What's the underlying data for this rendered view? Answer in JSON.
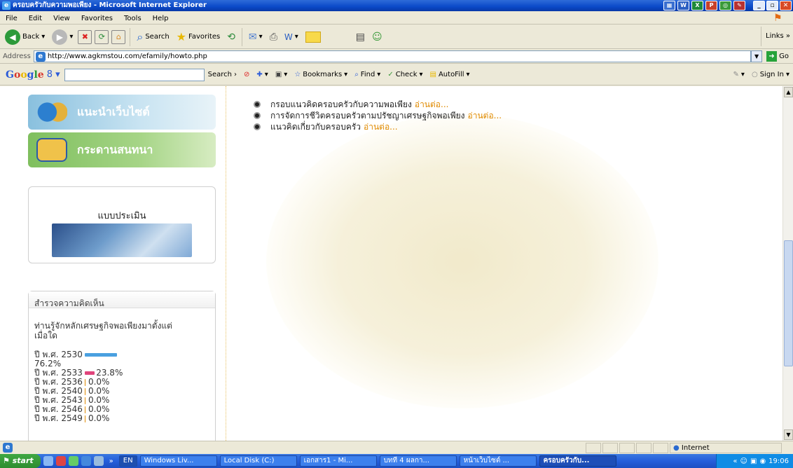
{
  "window": {
    "title": "ครอบครัวกับความพอเพียง - Microsoft Internet Explorer"
  },
  "menu": [
    "File",
    "Edit",
    "View",
    "Favorites",
    "Tools",
    "Help"
  ],
  "toolbar": {
    "back": "Back",
    "search": "Search",
    "favorites": "Favorites",
    "links": "Links"
  },
  "address": {
    "label": "Address",
    "url": "http://www.agkmstou.com/efamily/howto.php",
    "go": "Go"
  },
  "google": {
    "logo": "Google",
    "g8": "8",
    "search": "Search",
    "bookmarks": "Bookmarks",
    "find": "Find",
    "check": "Check",
    "autofill": "AutoFill",
    "signin": "Sign In"
  },
  "sidebar": {
    "nav1": "แนะนำเว็บไซต์",
    "nav2": "กระดานสนทนา",
    "eval_title": "แบบประเมิน"
  },
  "poll": {
    "title": "สำรวจความคิดเห็น",
    "question": "ท่านรู้จักหลักเศรษฐกิจพอเพียงมาตั้งแต่เมื่อใด",
    "options": [
      {
        "label": "ปี พ.ศ. 2530",
        "percent": "76.2%",
        "value": 76.2,
        "color": "#4aa0e0"
      },
      {
        "label": "ปี พ.ศ. 2533",
        "percent": "23.8%",
        "value": 23.8,
        "color": "#e0457b"
      },
      {
        "label": "ปี พ.ศ. 2536",
        "percent": "0.0%",
        "value": 0,
        "color": "#e08a00"
      },
      {
        "label": "ปี พ.ศ. 2540",
        "percent": "0.0%",
        "value": 0,
        "color": "#e08a00"
      },
      {
        "label": "ปี พ.ศ. 2543",
        "percent": "0.0%",
        "value": 0,
        "color": "#e08a00"
      },
      {
        "label": "ปี พ.ศ. 2546",
        "percent": "0.0%",
        "value": 0,
        "color": "#e08a00"
      },
      {
        "label": "ปี พ.ศ. 2549",
        "percent": "0.0%",
        "value": 0,
        "color": "#e08a00"
      }
    ]
  },
  "content": {
    "items": [
      {
        "text": "กรอบแนวคิดครอบครัวกับความพอเพียง",
        "more": "อ่านต่อ..."
      },
      {
        "text": "การจัดการชีวิตครอบครัวตามปรัชญาเศรษฐกิจพอเพียง",
        "more": "อ่านต่อ..."
      },
      {
        "text": "แนวคิดเกี่ยวกับครอบครัว",
        "more": "อ่านต่อ..."
      }
    ]
  },
  "status": {
    "zone": "Internet"
  },
  "taskbar": {
    "start": "start",
    "lang": "EN",
    "items": [
      {
        "label": "Windows Liv...",
        "active": false
      },
      {
        "label": "Local Disk (C:)",
        "active": false
      },
      {
        "label": "เอกสาร1 - Mi...",
        "active": false
      },
      {
        "label": "บทที่ 4 ผลกา...",
        "active": false
      },
      {
        "label": "หน้าเว็บไซต์ ...",
        "active": false
      },
      {
        "label": "ครอบครัวกับ...",
        "active": true
      }
    ],
    "clock": "19:06"
  },
  "colors": {
    "accent_link": "#e08a00",
    "titlebar": "#0a49c8",
    "taskbar": "#245edb"
  }
}
